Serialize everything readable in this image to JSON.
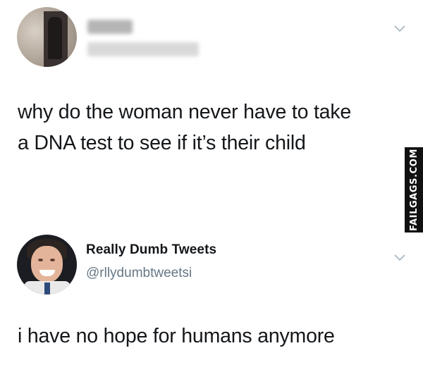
{
  "tweet1": {
    "avatar_icon": "blurred-profile-photo",
    "text_line1": "why do the woman never have to take",
    "text_line2": "a DNA test to see if it’s their child",
    "menu_icon": "chevron-down-icon"
  },
  "watermark": {
    "label": "FAILGAGS.COM"
  },
  "tweet2": {
    "avatar_icon": "profile-photo",
    "display_name": "Really Dumb Tweets",
    "handle": "@rllydumbtweetsi",
    "text": "i have no hope for humans anymore",
    "menu_icon": "chevron-down-icon"
  },
  "colors": {
    "text": "#14171a",
    "handle": "#657786",
    "chevron": "#aab8c2",
    "watermark_bg": "#111111"
  }
}
